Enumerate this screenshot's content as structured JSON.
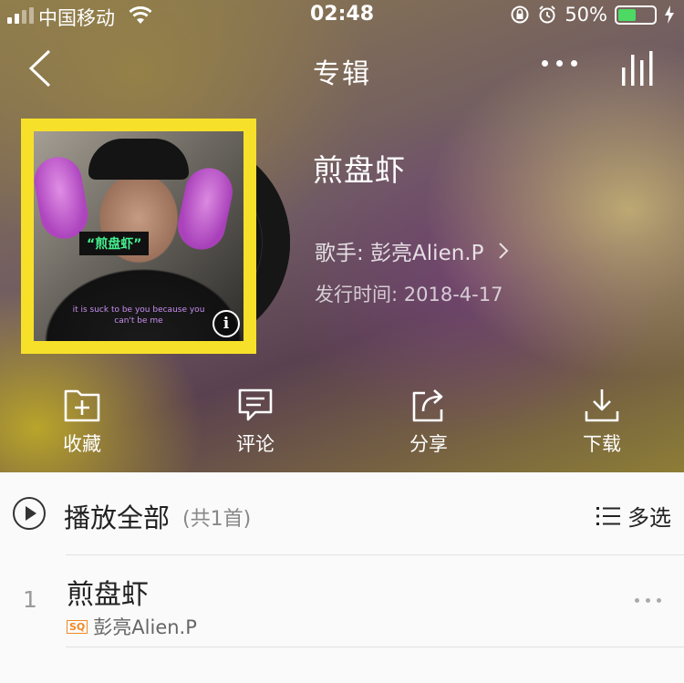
{
  "status_bar": {
    "carrier": "中国移动",
    "time": "02:48",
    "battery_percent": "50%",
    "battery_level": 0.5
  },
  "nav": {
    "title": "专辑"
  },
  "album": {
    "title": "煎盘虾",
    "cover_caption": "“煎盘虾”",
    "cover_text_line1": "it is suck to be you because you",
    "cover_text_line2": "can't be me",
    "artist_label": "歌手: 彭亮Alien.P",
    "release_label": "发行时间: 2018-4-17"
  },
  "actions": [
    {
      "label": "收藏",
      "icon": "add-folder-icon"
    },
    {
      "label": "评论",
      "icon": "comment-icon"
    },
    {
      "label": "分享",
      "icon": "share-icon"
    },
    {
      "label": "下载",
      "icon": "download-icon"
    }
  ],
  "list": {
    "play_all": "播放全部",
    "count": "(共1首)",
    "multi_select": "多选",
    "tracks": [
      {
        "index": "1",
        "title": "煎盘虾",
        "quality_badge": "SQ",
        "artist": "彭亮Alien.P"
      }
    ]
  },
  "colors": {
    "cover_border": "#f7e02a",
    "battery_fill": "#4cd964",
    "sq_badge": "#f08a24"
  }
}
